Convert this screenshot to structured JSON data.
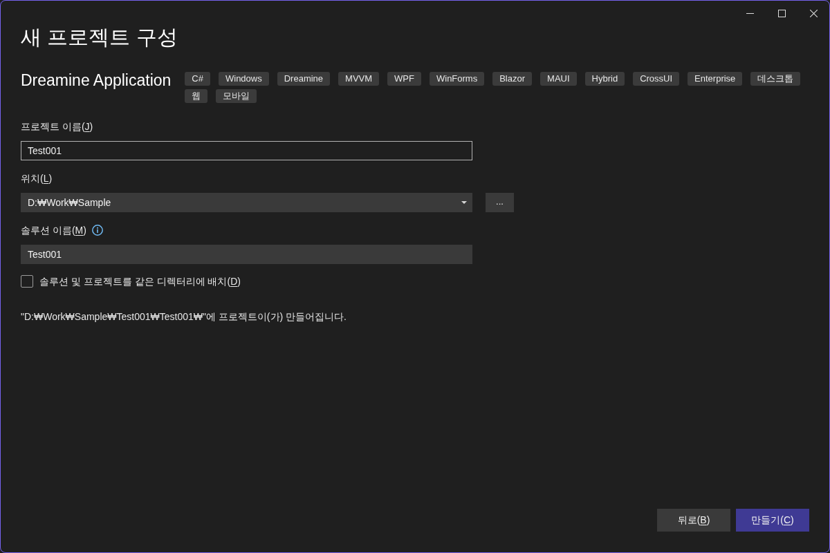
{
  "window": {
    "title": "새 프로젝트 구성"
  },
  "template": {
    "name": "Dreamine Application",
    "tags": [
      "C#",
      "Windows",
      "Dreamine",
      "MVVM",
      "WPF",
      "WinForms",
      "Blazor",
      "MAUI",
      "Hybrid",
      "CrossUI",
      "Enterprise",
      "데스크톱",
      "웹",
      "모바일"
    ]
  },
  "fields": [
    {
      "kind": "text",
      "label": "프로젝트 이름(J)",
      "mnemonic": true,
      "value": "Test001",
      "focused": true
    },
    {
      "kind": "dropdown",
      "label": "위치(L)",
      "mnemonic": true,
      "value": "D:₩Work₩Sample",
      "browse_button": "..."
    },
    {
      "kind": "text",
      "label": "솔루션 이름(M)",
      "mnemonic": true,
      "value": "Test001",
      "focused": false,
      "info": true
    }
  ],
  "checkbox": {
    "label": "솔루션 및 프로젝트를 같은 디렉터리에 배치(D)",
    "mnemonic": true,
    "checked": false
  },
  "output_note": "\"D:₩Work₩Sample₩Test001₩Test001₩\"에 프로젝트이(가) 만들어집니다.",
  "buttons": [
    {
      "label": "뒤로(B)",
      "mnemonic": true,
      "primary": false
    },
    {
      "label": "만들기(C)",
      "mnemonic": true,
      "primary": true
    }
  ]
}
